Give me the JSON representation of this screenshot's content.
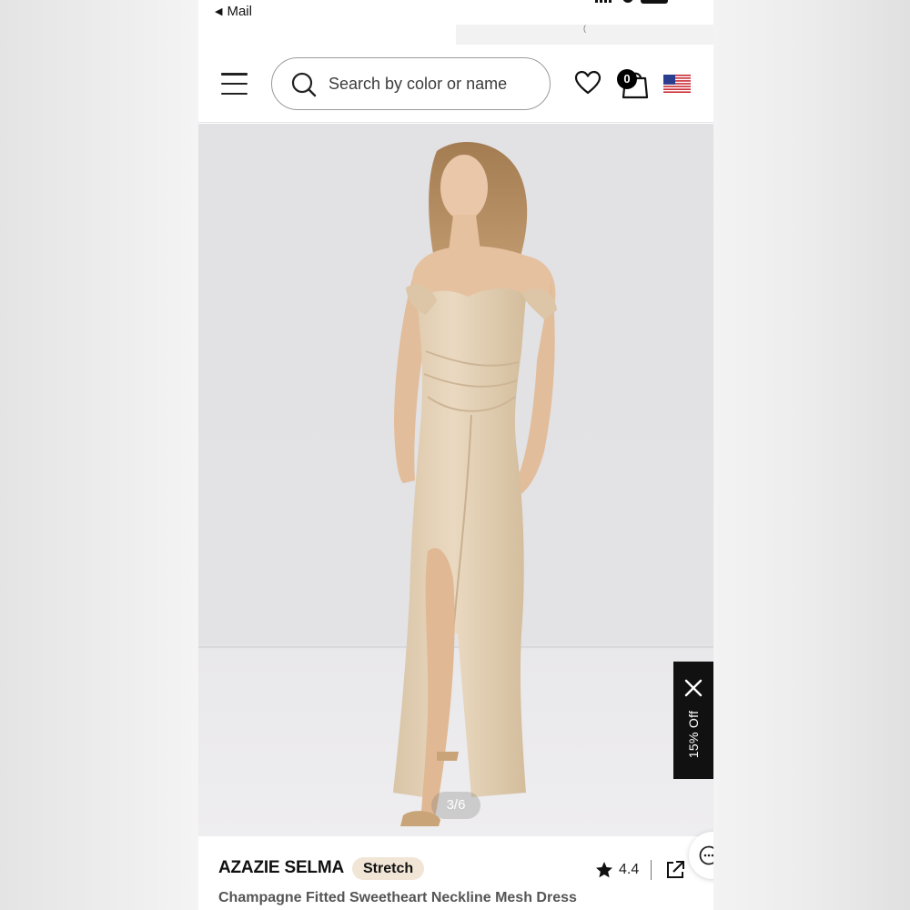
{
  "status_bar": {
    "back_label": "Mail",
    "back_icon": "back-triangle-icon",
    "url_fragment": "("
  },
  "header": {
    "menu_icon": "hamburger-icon",
    "search": {
      "icon": "search-icon",
      "placeholder": "Search by color or name",
      "value": ""
    },
    "wishlist_icon": "heart-icon",
    "cart": {
      "icon": "shopping-bag-icon",
      "count": "0"
    },
    "region_icon": "us-flag-icon"
  },
  "gallery": {
    "counter": "3/6",
    "current": 3,
    "total": 6
  },
  "promo": {
    "label": "15% Off",
    "close_icon": "close-icon"
  },
  "product": {
    "brand": "AZAZIE SELMA",
    "badge": "Stretch",
    "rating": "4.4",
    "subtitle": "Champagne Fitted Sweetheart Neckline Mesh Dress"
  },
  "colors": {
    "accent_badge_bg": "#f1e6d6",
    "dress": "#e2cfb4",
    "background": "#e2e1e4",
    "promo_bg": "#111111"
  }
}
